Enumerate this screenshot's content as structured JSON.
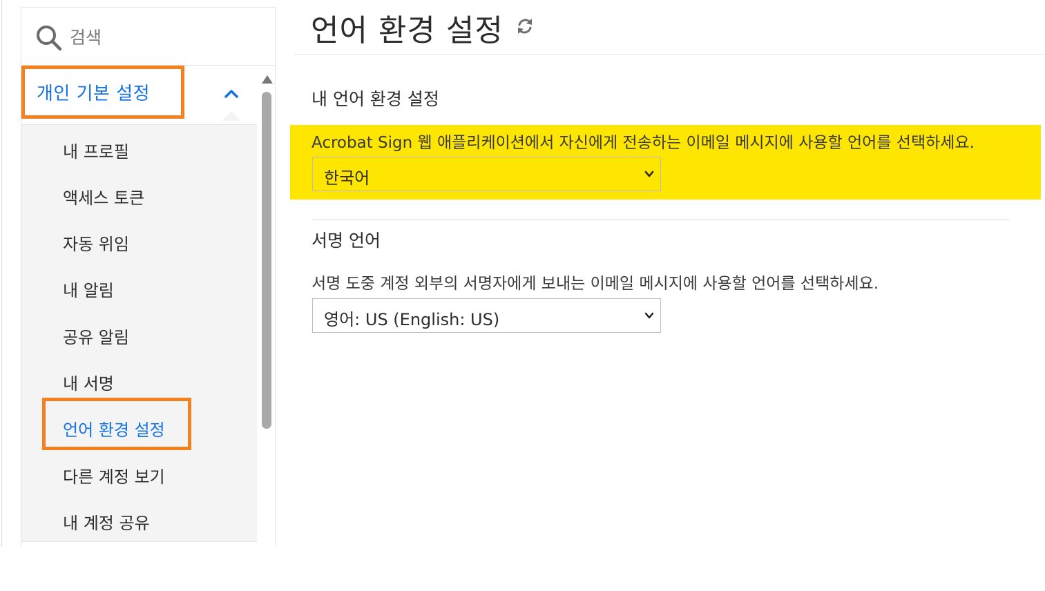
{
  "sidebar": {
    "search": {
      "placeholder": "검색"
    },
    "section": {
      "title": "개인 기본 설정"
    },
    "items": [
      {
        "label": "내 프로필"
      },
      {
        "label": "액세스 토큰"
      },
      {
        "label": "자동 위임"
      },
      {
        "label": "내 알림"
      },
      {
        "label": "공유 알림"
      },
      {
        "label": "내 서명"
      },
      {
        "label": "언어 환경 설정"
      },
      {
        "label": "다른 계정 보기"
      },
      {
        "label": "내 계정 공유"
      }
    ],
    "active_index": 6
  },
  "main": {
    "title": "언어 환경 설정",
    "my_language": {
      "heading": "내 언어 환경 설정",
      "description": "Acrobat Sign 웹 애플리케이션에서 자신에게 전송하는 이메일 메시지에 사용할 언어를 선택하세요.",
      "selected": "한국어"
    },
    "signing_language": {
      "heading": "서명 언어",
      "description": "서명 도중 계정 외부의 서명자에게 보내는 이메일 메시지에 사용할 언어를 선택하세요.",
      "selected": "영어: US (English: US)"
    }
  },
  "colors": {
    "accent_blue": "#1473e6",
    "highlight_orange": "#f4811f",
    "highlight_yellow": "#ffe600",
    "menu_bg": "#f4f4f4"
  },
  "icons": {
    "search": "search-icon",
    "collapse": "chevron-up-icon",
    "refresh": "refresh-icon",
    "dropdown": "chevron-down-icon"
  }
}
